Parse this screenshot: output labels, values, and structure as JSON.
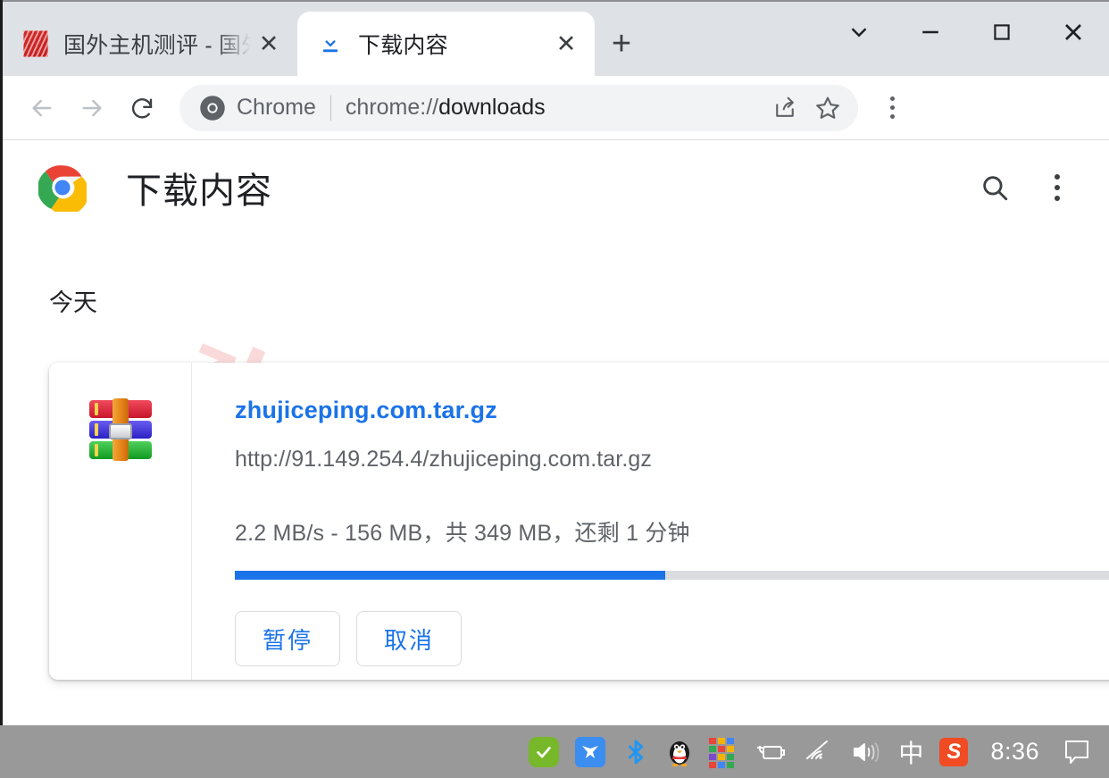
{
  "window": {
    "controls": [
      {
        "name": "tab-search",
        "glyph": "chevron-down"
      },
      {
        "name": "minimize",
        "glyph": "minus"
      },
      {
        "name": "maximize",
        "glyph": "square"
      },
      {
        "name": "close",
        "glyph": "cross"
      }
    ]
  },
  "tabs": [
    {
      "title": "国外主机测评 - 国外V",
      "favicon": "red-site-favicon",
      "active": false,
      "close_label": "✕"
    },
    {
      "title": "下载内容",
      "favicon": "download-arrow-icon",
      "active": true,
      "close_label": "✕"
    }
  ],
  "new_tab_label": "+",
  "toolbar": {
    "back_icon": "back-arrow-icon",
    "forward_icon": "forward-arrow-icon",
    "reload_icon": "reload-icon",
    "brand": "Chrome",
    "url_prefix": "chrome://",
    "url_suffix": "downloads",
    "url_full": "chrome://downloads",
    "share_icon": "share-icon",
    "bookmark_icon": "star-icon",
    "menu_icon": "three-dot-menu-icon"
  },
  "page": {
    "title": "下载内容",
    "logo": "chrome-logo",
    "search_icon": "search-icon",
    "menu_icon": "three-dot-menu-icon",
    "watermark": "zhujiceping.com",
    "date_group": "今天"
  },
  "download": {
    "file_icon": "winrar-archive-icon",
    "filename": "zhujiceping.com.tar.gz",
    "url": "http://91.149.254.4/zhujiceping.com.tar.gz",
    "status": "2.2 MB/s - 156 MB，共 349 MB，还剩 1 分钟",
    "speed": "2.2 MB/s",
    "downloaded": "156 MB",
    "total": "349 MB",
    "time_left": "还剩 1 分钟",
    "progress_percent": 45,
    "progress_color": "#1a73e8",
    "track_color": "#dadce0",
    "pause_label": "暂停",
    "cancel_label": "取消"
  },
  "taskbar": {
    "icons": [
      {
        "name": "security-check-icon",
        "glyph": "✔"
      },
      {
        "name": "blue-bird-icon",
        "glyph": "▼"
      },
      {
        "name": "bluetooth-icon",
        "glyph": "bluetooth"
      },
      {
        "name": "qq-penguin-icon",
        "glyph": "penguin"
      },
      {
        "name": "color-squares-icon",
        "glyph": "squares"
      },
      {
        "name": "battery-icon",
        "glyph": "battery"
      },
      {
        "name": "wifi-icon",
        "glyph": "wifi"
      },
      {
        "name": "volume-icon",
        "glyph": "speaker"
      },
      {
        "name": "ime-chinese-icon",
        "glyph": "中"
      },
      {
        "name": "sogou-input-icon",
        "glyph": "S"
      }
    ],
    "clock": "8:36",
    "notification_icon": "notification-icon"
  },
  "colors": {
    "accent": "#1a73e8",
    "tabstrip": "#dee1e6",
    "omnibox": "#f1f3f4",
    "taskbar": "#999999",
    "watermark": "#f9d9d9"
  }
}
